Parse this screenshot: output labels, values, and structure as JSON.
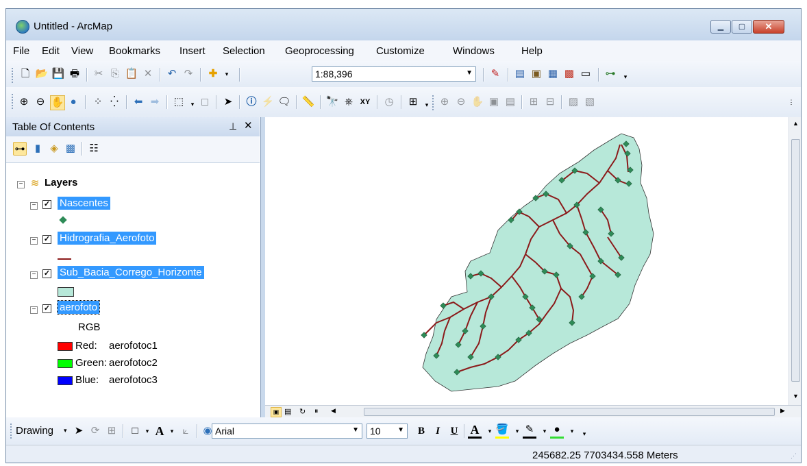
{
  "window": {
    "title": "Untitled - ArcMap"
  },
  "menu": [
    "File",
    "Edit",
    "View",
    "Bookmarks",
    "Insert",
    "Selection",
    "Geoprocessing",
    "Customize",
    "Windows",
    "Help"
  ],
  "standard_toolbar": {
    "scale": "1:88,396"
  },
  "toc": {
    "title": "Table Of Contents",
    "root": "Layers",
    "layers": [
      {
        "name": "Nascentes",
        "checked": true
      },
      {
        "name": "Hidrografia_Aerofoto",
        "checked": true
      },
      {
        "name": "Sub_Bacia_Corrego_Horizonte",
        "checked": true
      },
      {
        "name": "aerofoto",
        "checked": true
      }
    ],
    "rgb": {
      "label": "RGB",
      "bands": [
        {
          "label": "Red:",
          "value": "aerofotoc1",
          "color": "#ff0000"
        },
        {
          "label": "Green:",
          "value": "aerofotoc2",
          "color": "#00ff00"
        },
        {
          "label": "Blue:",
          "value": "aerofotoc3",
          "color": "#0000ff"
        }
      ]
    }
  },
  "colors": {
    "basin_fill": "#b7e8d9",
    "stream": "#8b1a1a",
    "spring": "#2e8b57"
  },
  "drawing_toolbar": {
    "label": "Drawing",
    "font": "Arial",
    "size": "10",
    "bold": "B",
    "italic": "I",
    "underline": "U",
    "text_tool": "A"
  },
  "status": {
    "coords": "245682.25  7703434.558 Meters"
  }
}
